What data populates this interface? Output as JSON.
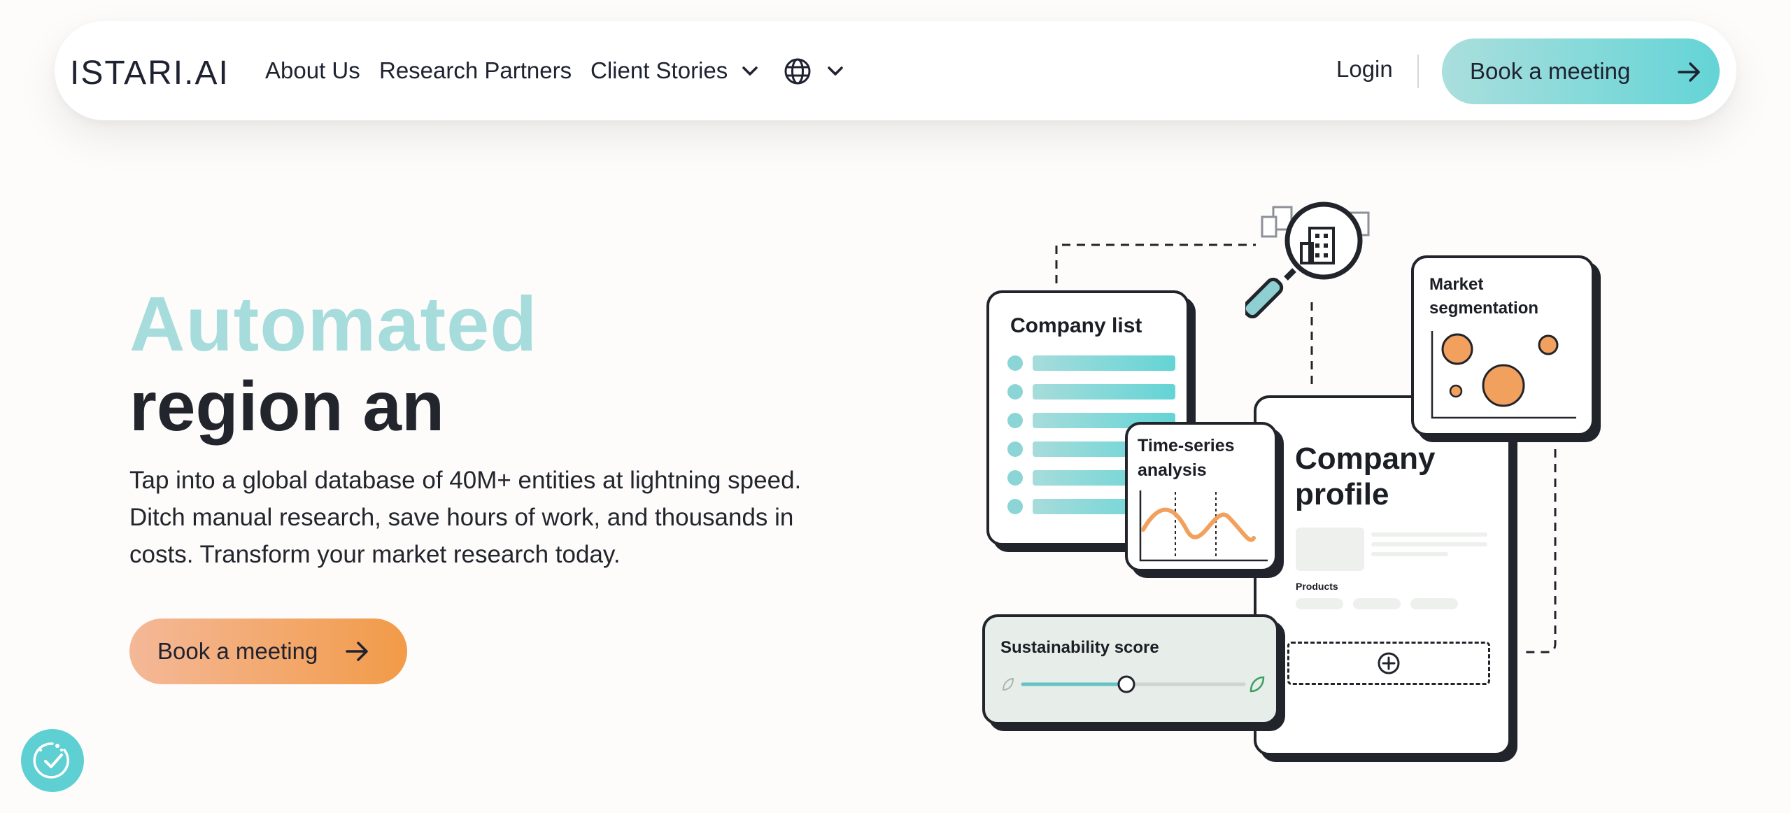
{
  "nav": {
    "logo_text": "ISTARI.AI",
    "links": [
      "About Us",
      "Research Partners",
      "Client Stories"
    ],
    "login": "Login",
    "cta": "Book a meeting"
  },
  "hero": {
    "line1": "Automated",
    "line2": "region an",
    "description": "Tap into a global database of 40M+ entities at lightning speed. Ditch manual research, save hours of work, and thousands in costs. Transform your market research today.",
    "cta": "Book a meeting"
  },
  "illustration": {
    "company_list": "Company list",
    "market_segmentation_line1": "Market",
    "market_segmentation_line2": "segmentation",
    "time_series_line1": "Time-series",
    "time_series_line2": "analysis",
    "company_profile_line1": "Company",
    "company_profile_line2": "profile",
    "products": "Products",
    "sustainability": "Sustainability score"
  },
  "colors": {
    "teal": "#64d4d6",
    "teal_light": "#a6dcdb",
    "orange": "#f29b48",
    "dark": "#23252d",
    "background": "#fdfcfb"
  },
  "sustainability_slider_level": 0.47
}
